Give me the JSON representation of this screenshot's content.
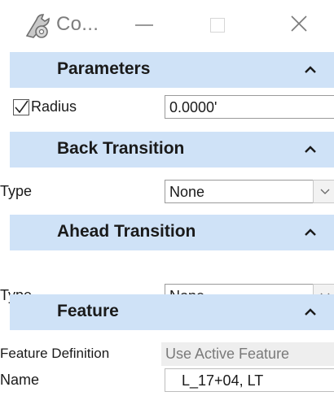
{
  "window": {
    "title": "Co...",
    "app_icon": "tools-icon",
    "controls": [
      "minimize-icon",
      "maximize-icon",
      "close-icon"
    ]
  },
  "parameters": {
    "title": "Parameters",
    "radius": {
      "label": "Radius",
      "checked": true,
      "value": "0.0000'"
    }
  },
  "back_transition": {
    "title": "Back Transition",
    "type": {
      "label": "Type",
      "value": "None"
    }
  },
  "ahead_transition": {
    "title": "Ahead Transition",
    "type": {
      "label": "Type",
      "value": "None"
    }
  },
  "feature": {
    "title": "Feature",
    "definition": {
      "label": "Feature Definition",
      "value": "Use Active Feature"
    },
    "name": {
      "label": "Name",
      "value": "L_17+04, LT"
    }
  },
  "colors": {
    "section_header": "#cfe2f7",
    "title_text": "#7d7d7d"
  }
}
